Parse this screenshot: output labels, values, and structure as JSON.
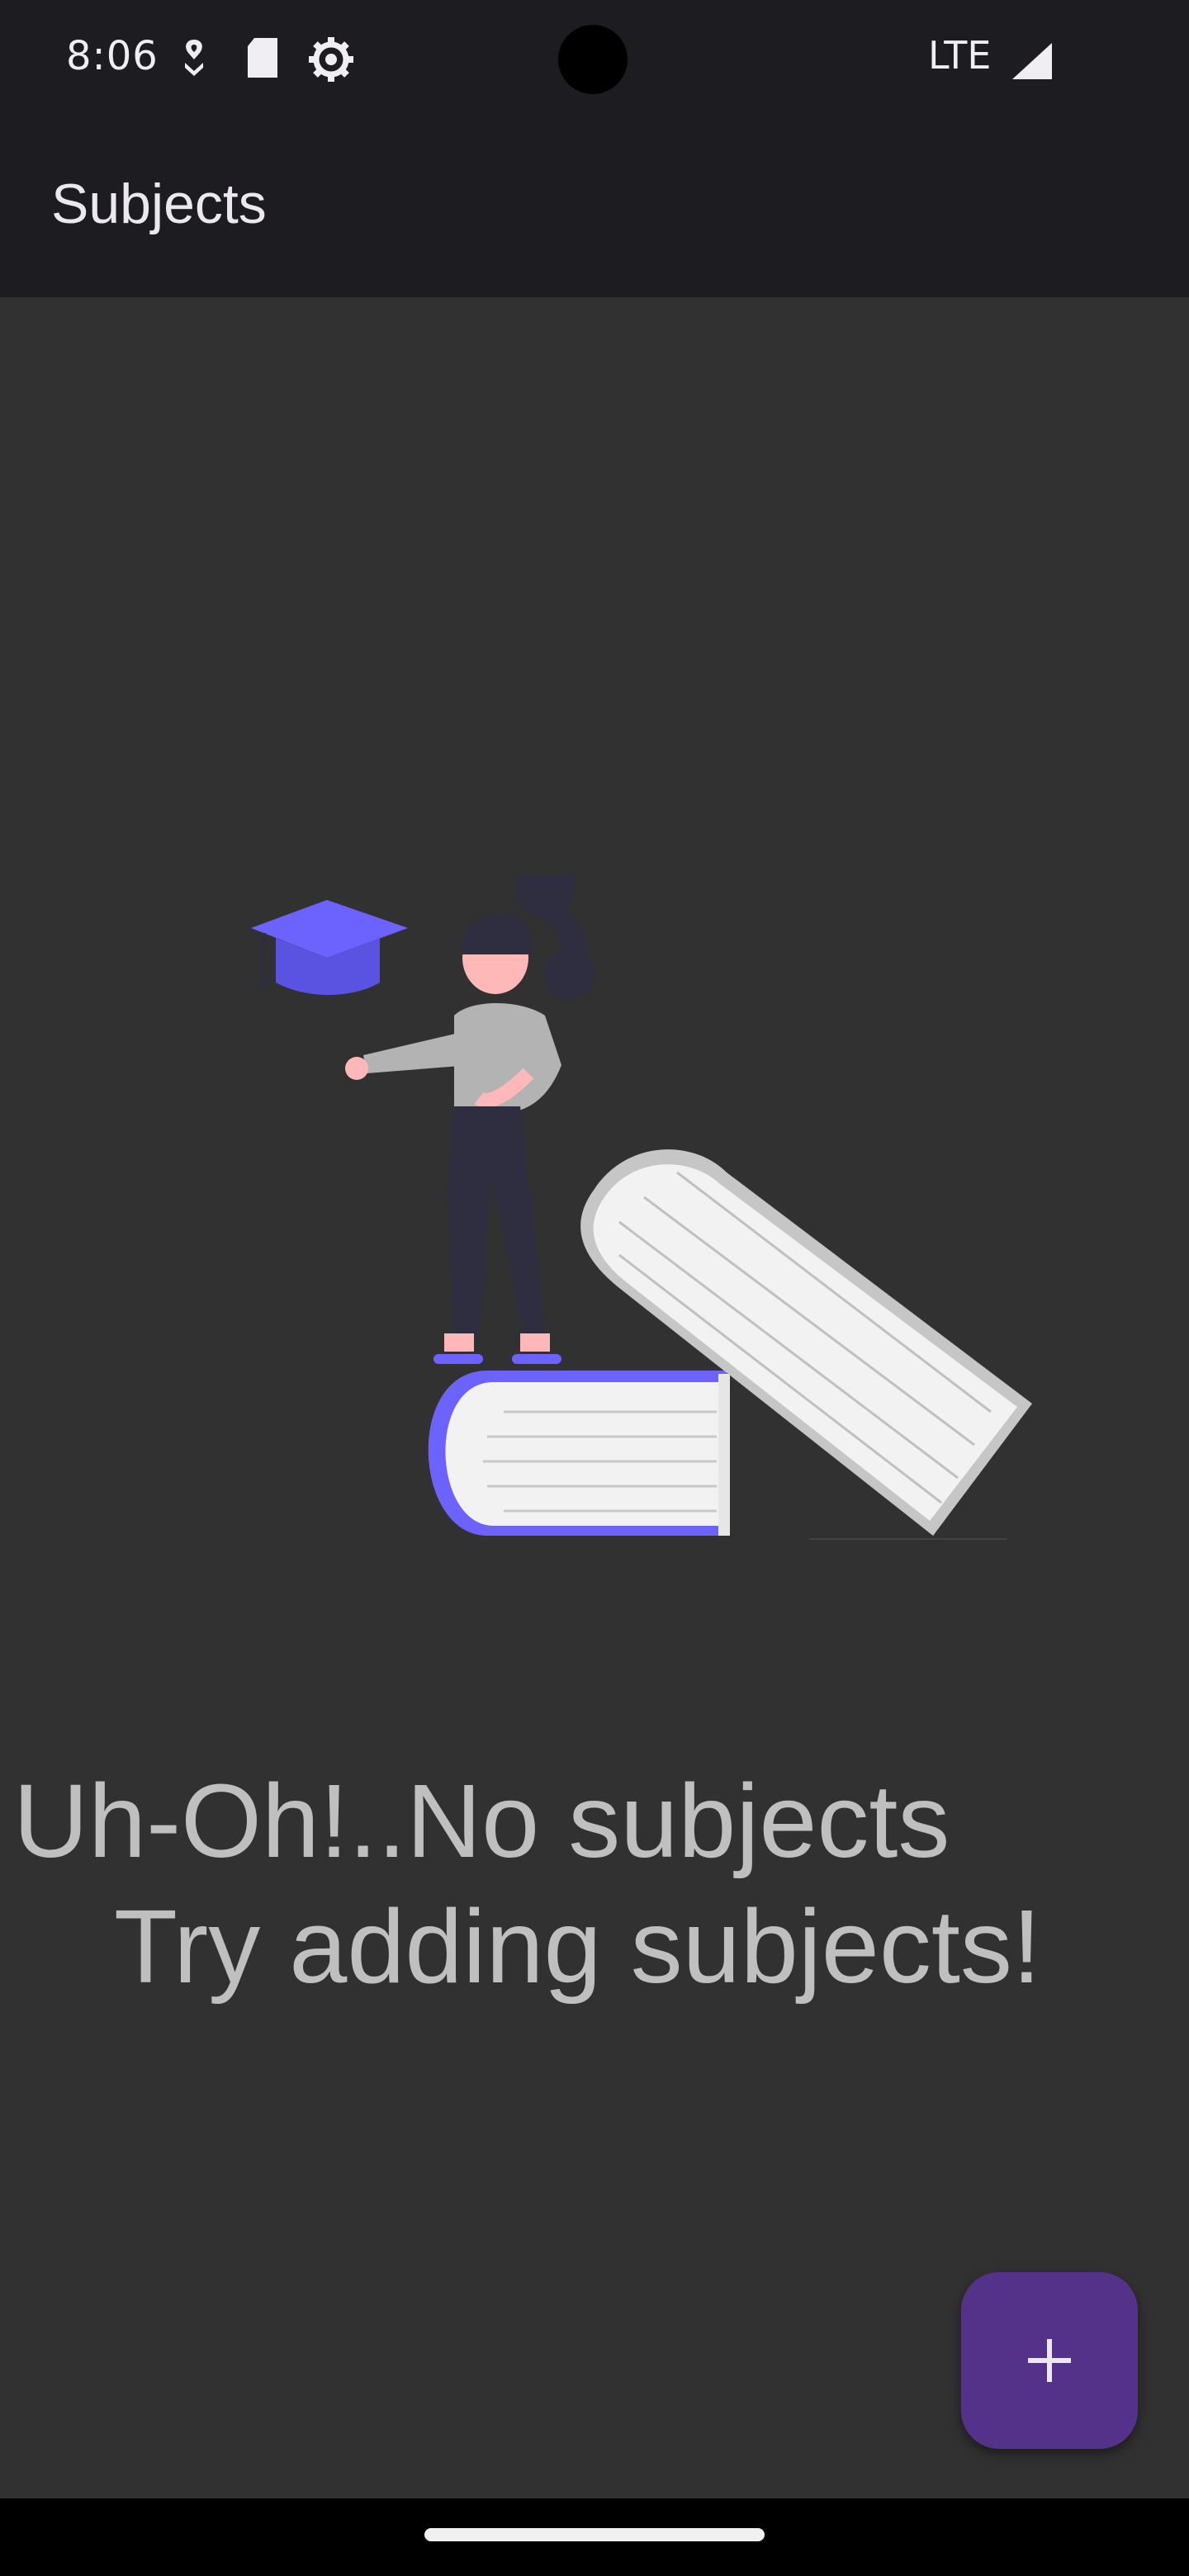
{
  "status_bar": {
    "time": "8:06",
    "network": "LTE",
    "icons": [
      "location-icon",
      "sd-card-icon",
      "settings-gear-icon",
      "signal-icon"
    ]
  },
  "app_bar": {
    "title": "Subjects"
  },
  "empty_state": {
    "line1": "Uh-Oh!..No subjects",
    "line2": "Try adding subjects!"
  },
  "fab": {
    "icon": "plus-icon"
  },
  "colors": {
    "background": "#313131",
    "app_bar": "#1d1c20",
    "fab": "#553289",
    "accent_illustration": "#6c63ff",
    "text": "#bfbfbf"
  }
}
